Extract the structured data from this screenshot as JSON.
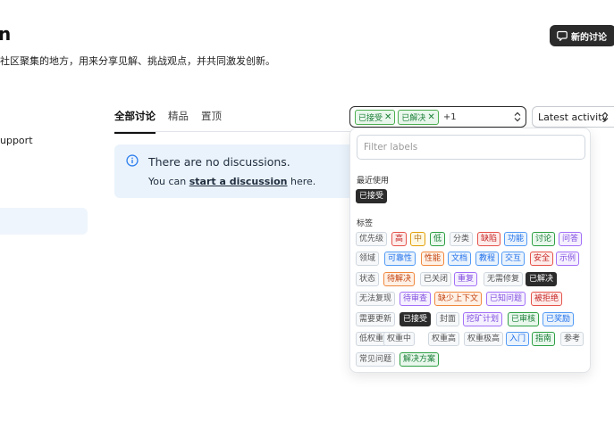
{
  "page": {
    "title": "n",
    "subtitle": "社区聚集的地方，用来分享见解、挑战观点，并共同激发创新。",
    "new_button_label": "新的讨论"
  },
  "sidebar": {
    "item_label": "upport"
  },
  "tabs": [
    {
      "label": "全部讨论",
      "active": true
    },
    {
      "label": "精品",
      "active": false
    },
    {
      "label": "置顶",
      "active": false
    }
  ],
  "empty_state": {
    "title": "There are no discussions.",
    "text_before": "You can ",
    "link": "start a discussion",
    "text_after": " here."
  },
  "filter": {
    "selected": [
      "已接受",
      "已解决"
    ],
    "more_count": "+1",
    "sort_label": "Latest activity"
  },
  "dropdown": {
    "placeholder": "Filter labels",
    "recent_heading": "最近使用",
    "recent": [
      "已接受"
    ],
    "labels_heading": "标签",
    "rows": [
      [
        "优先级",
        "高",
        "中",
        "低",
        "分类",
        "缺陷",
        "功能",
        "讨论",
        "问答"
      ],
      [
        "领域",
        "可靠性",
        "性能",
        "文档",
        "教程",
        "交互",
        "安全",
        "示例"
      ],
      [
        "状态",
        "待解决",
        "已关闭",
        "重复",
        "无需修复",
        "已解决"
      ],
      [
        "无法复现",
        "待审查",
        "缺少上下文",
        "已知问题",
        "被拒绝"
      ],
      [
        "需要更新",
        "已接受",
        "封面",
        "挖矿计划",
        "已审核",
        "已奖励"
      ],
      [
        "低权重",
        "权重中",
        "权重高",
        "权重极高",
        "入门",
        "指南",
        "参考"
      ],
      [
        "常见问题",
        "解决方案"
      ]
    ]
  },
  "colors": {
    "accent_dark": "#2b2b2b",
    "info_bg": "#eaf3fc",
    "selected_chip": "#4caf50"
  }
}
